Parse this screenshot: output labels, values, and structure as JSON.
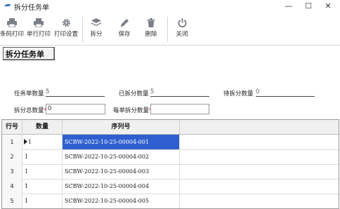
{
  "window": {
    "title": "拆分任务单",
    "controls": {
      "minimize": "—",
      "maximize": "☐",
      "close": "✕"
    }
  },
  "toolbar": {
    "items": [
      {
        "label": "条码打印",
        "icon": "printer-icon"
      },
      {
        "label": "单行打印",
        "icon": "printer-icon"
      },
      {
        "label": "打印设置",
        "icon": "gear-icon"
      },
      {
        "label": "拆分",
        "icon": "layers-icon"
      },
      {
        "label": "保存",
        "icon": "pen-icon"
      },
      {
        "label": "删除",
        "icon": "trash-icon"
      },
      {
        "label": "关闭",
        "icon": "power-icon"
      }
    ]
  },
  "section": {
    "title": "拆分任务单"
  },
  "form": {
    "task_qty_label": "任务单数量",
    "task_qty_value": "5",
    "split_done_label": "已拆分数量",
    "split_done_value": "5",
    "pending_label": "待拆分数量",
    "pending_value": "0",
    "total_split_label": "拆分总数量",
    "total_split_value": "0",
    "per_split_label": "每单拆分数量",
    "per_split_value": "",
    "required_mark": "*"
  },
  "grid": {
    "columns": [
      "行号",
      "数量",
      "序列号"
    ],
    "rows": [
      {
        "no": "1",
        "qty": "1",
        "serial": "SCBW-2022-10-25-00004-001"
      },
      {
        "no": "2",
        "qty": "1",
        "serial": "SCBW-2022-10-25-00004-002"
      },
      {
        "no": "3",
        "qty": "1",
        "serial": "SCBW-2022-10-25-00004-003"
      },
      {
        "no": "4",
        "qty": "1",
        "serial": "SCBW-2022-10-25-00004-004"
      },
      {
        "no": "5",
        "qty": "1",
        "serial": "SCBW-2022-10-25-00004-005"
      }
    ]
  },
  "colors": {
    "selection": "#2f5fcf",
    "required": "#dd2222",
    "icon": "#7a7f87"
  }
}
